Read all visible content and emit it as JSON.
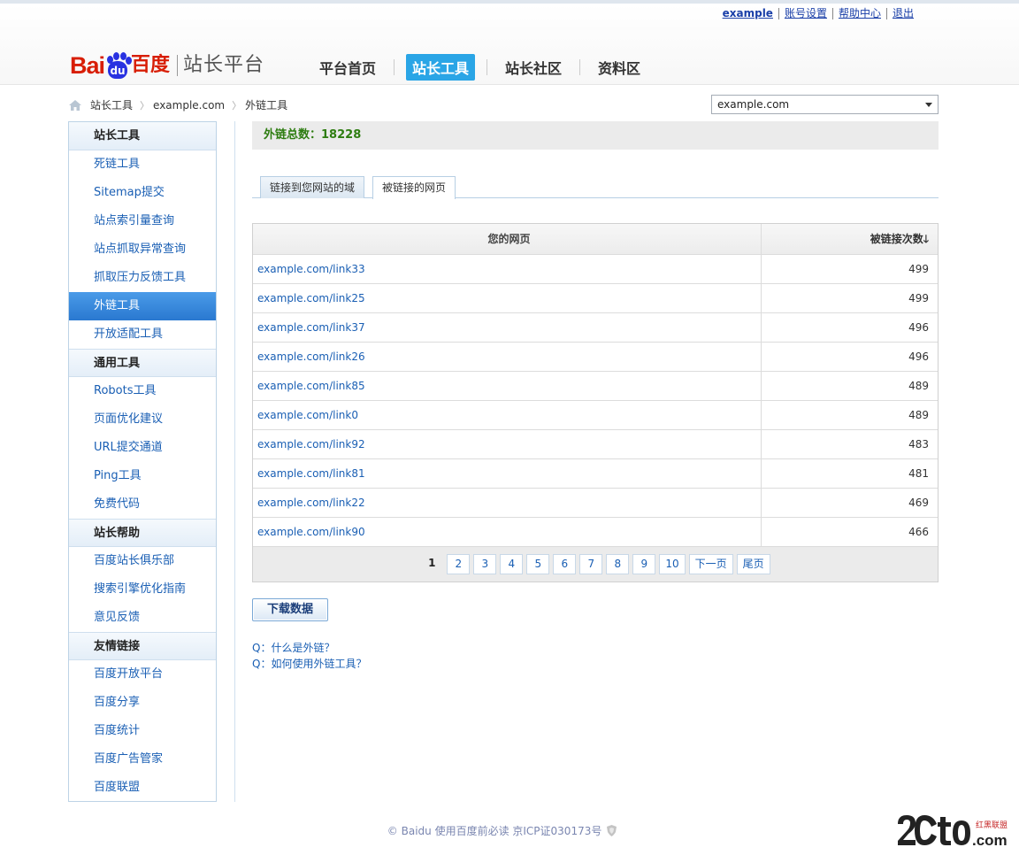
{
  "top_links": [
    "example",
    "账号设置",
    "帮助中心",
    "退出"
  ],
  "logo": {
    "bai": "Bai",
    "du": "du",
    "cn": "百度",
    "sub": "站长平台"
  },
  "main_nav": [
    {
      "label": "平台首页",
      "active": false
    },
    {
      "label": "站长工具",
      "active": true
    },
    {
      "label": "站长社区",
      "active": false
    },
    {
      "label": "资料区",
      "active": false
    }
  ],
  "breadcrumb": [
    "站长工具",
    "example.com",
    "外链工具"
  ],
  "site_select": {
    "value": "example.com"
  },
  "sidebar": {
    "sections": [
      {
        "title": "站长工具",
        "items": [
          "死链工具",
          "Sitemap提交",
          "站点索引量查询",
          "站点抓取异常查询",
          "抓取压力反馈工具",
          "外链工具",
          "开放适配工具"
        ]
      },
      {
        "title": "通用工具",
        "items": [
          "Robots工具",
          "页面优化建议",
          "URL提交通道",
          "Ping工具",
          "免费代码"
        ]
      },
      {
        "title": "站长帮助",
        "items": [
          "百度站长俱乐部",
          "搜索引擎优化指南",
          "意见反馈"
        ]
      },
      {
        "title": "友情链接",
        "items": [
          "百度开放平台",
          "百度分享",
          "百度统计",
          "百度广告管家",
          "百度联盟"
        ]
      }
    ],
    "active_item": "外链工具"
  },
  "summary": {
    "label": "外链总数：",
    "value": "18228"
  },
  "tabs": [
    {
      "label": "链接到您网站的域",
      "active": false
    },
    {
      "label": "被链接的网页",
      "active": true
    }
  ],
  "table": {
    "headers": [
      "您的网页",
      "被链接次数"
    ],
    "rows": [
      {
        "page": "example.com/link33",
        "count": "499"
      },
      {
        "page": "example.com/link25",
        "count": "499"
      },
      {
        "page": "example.com/link37",
        "count": "496"
      },
      {
        "page": "example.com/link26",
        "count": "496"
      },
      {
        "page": "example.com/link85",
        "count": "489"
      },
      {
        "page": "example.com/link0",
        "count": "489"
      },
      {
        "page": "example.com/link92",
        "count": "483"
      },
      {
        "page": "example.com/link81",
        "count": "481"
      },
      {
        "page": "example.com/link22",
        "count": "469"
      },
      {
        "page": "example.com/link90",
        "count": "466"
      }
    ]
  },
  "pager": {
    "current": "1",
    "pages": [
      "2",
      "3",
      "4",
      "5",
      "6",
      "7",
      "8",
      "9",
      "10"
    ],
    "next": "下一页",
    "last": "尾页"
  },
  "download_button": "下载数据",
  "faq": [
    "Q：什么是外链？",
    "Q：如何使用外链工具？"
  ],
  "footer": "© Baidu 使用百度前必读 京ICP证030173号",
  "colors": {
    "accent": "#2aa5e6",
    "sidebar_active": "#2a78d0",
    "link": "#1a5fb4",
    "summary_green": "#2e7d11",
    "logo_red": "#d81e06",
    "logo_blue": "#2932e1"
  }
}
